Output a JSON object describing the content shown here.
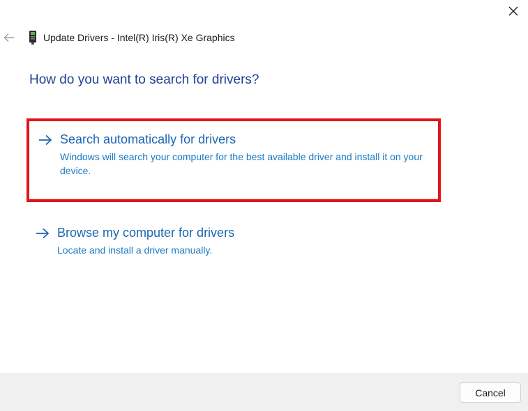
{
  "window": {
    "title": "Update Drivers - Intel(R) Iris(R) Xe Graphics",
    "close_icon": "close-icon",
    "back_icon": "back-arrow-icon",
    "device_icon": "device-icon"
  },
  "main": {
    "heading": "How do you want to search for drivers?",
    "options": [
      {
        "title": "Search automatically for drivers",
        "description": "Windows will search your computer for the best available driver and install it on your device.",
        "icon": "arrow-right-icon",
        "highlighted": true,
        "highlight_color": "#e0151c"
      },
      {
        "title": "Browse my computer for drivers",
        "description": "Locate and install a driver manually.",
        "icon": "arrow-right-icon",
        "highlighted": false
      }
    ]
  },
  "footer": {
    "cancel_label": "Cancel"
  },
  "colors": {
    "heading": "#1c3f94",
    "link": "#1a66b0",
    "footer_bg": "#f0f0f0"
  }
}
